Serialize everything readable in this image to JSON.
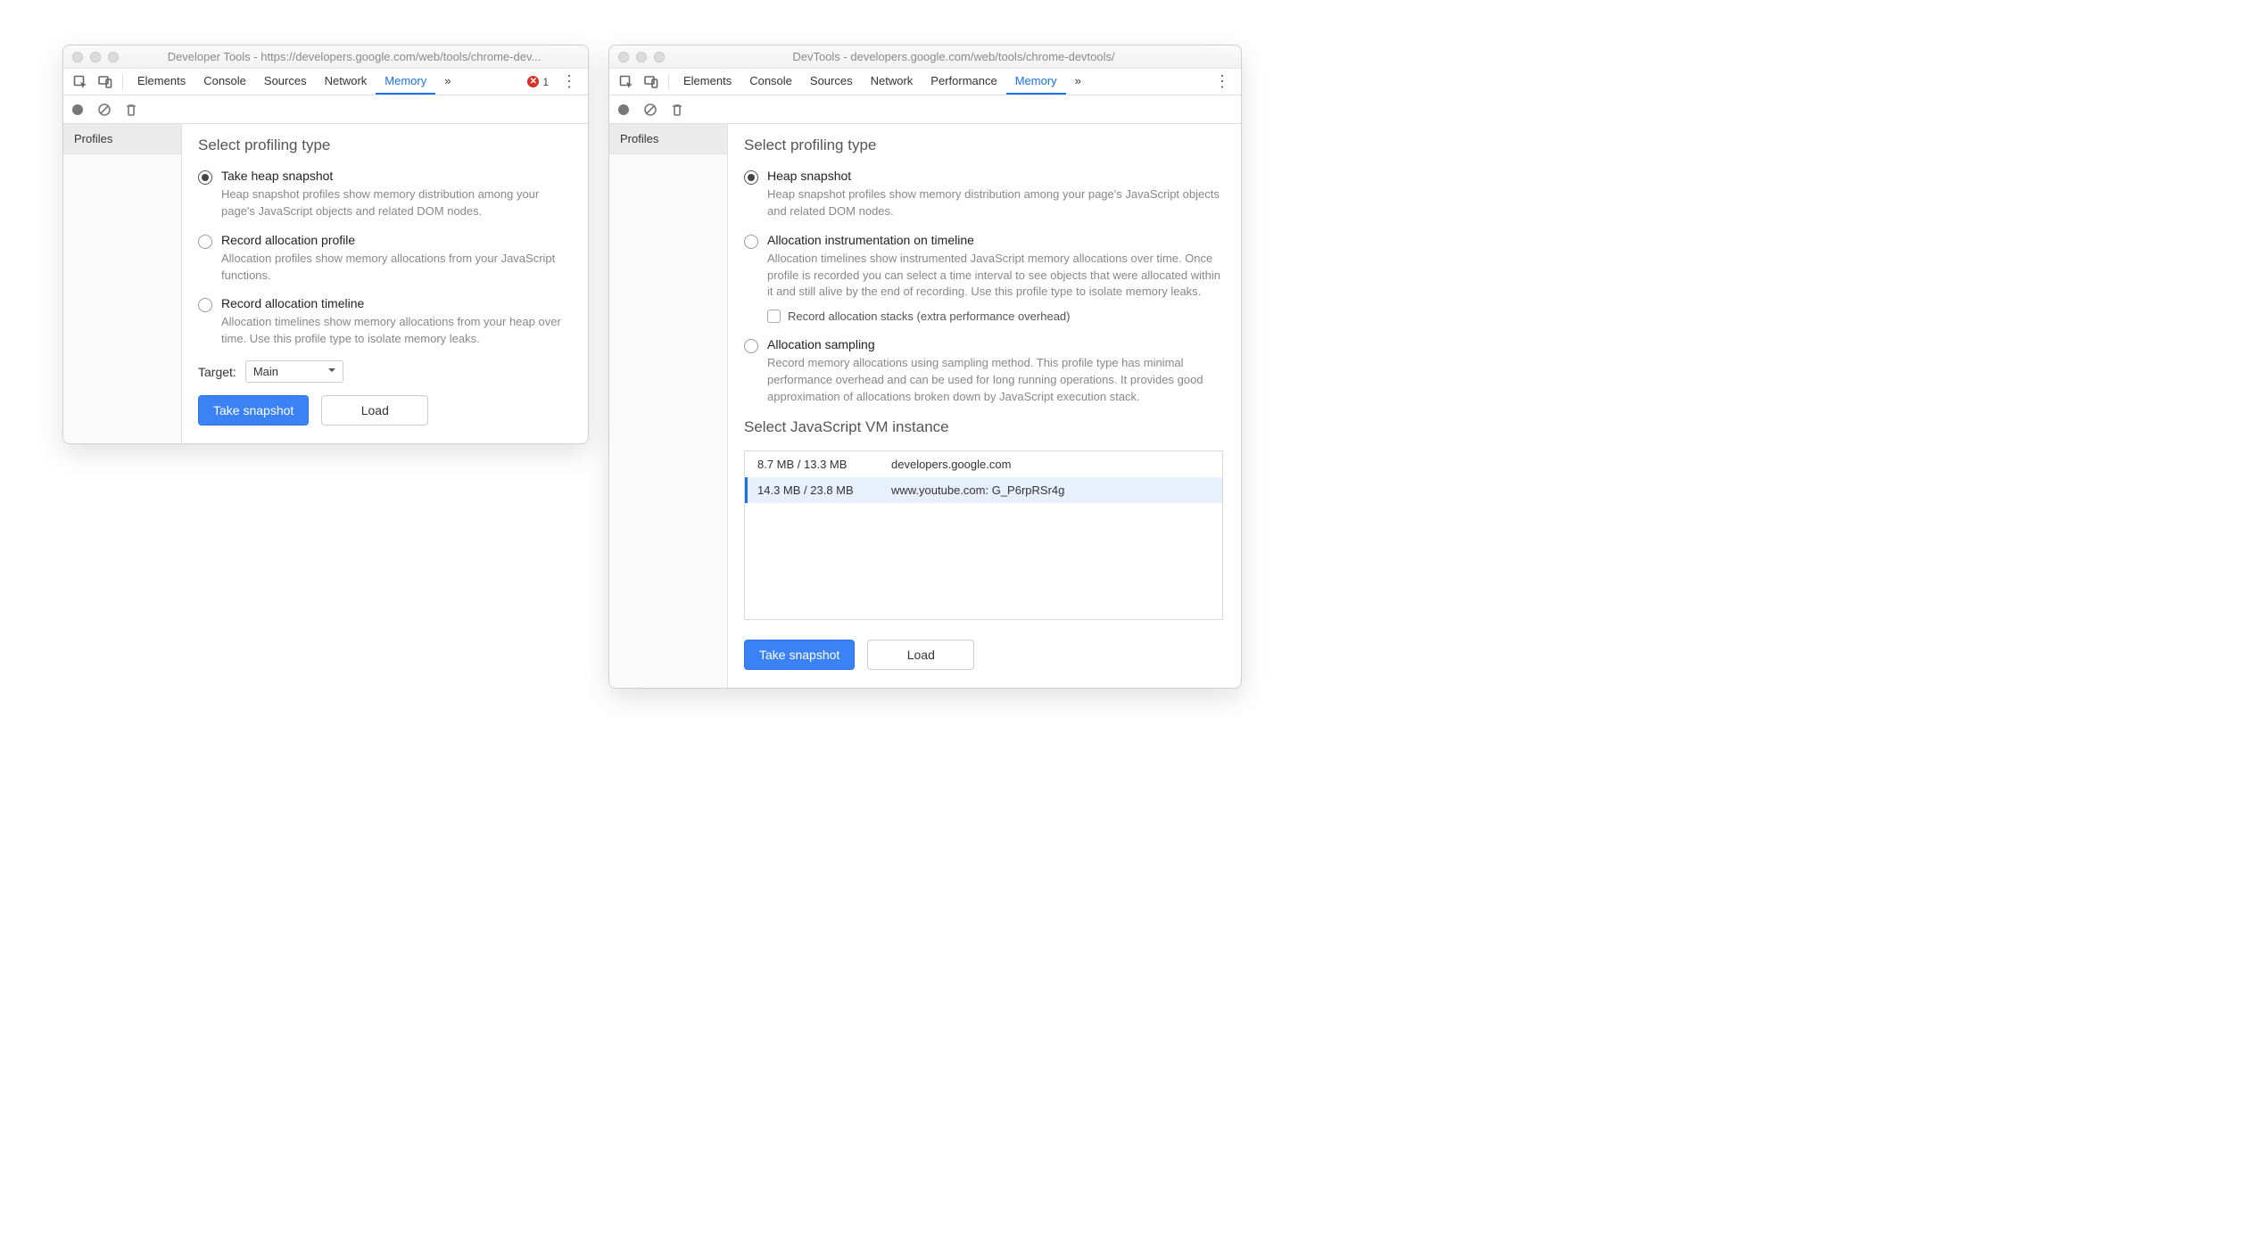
{
  "left": {
    "title": "Developer Tools - https://developers.google.com/web/tools/chrome-dev...",
    "tabs": [
      "Elements",
      "Console",
      "Sources",
      "Network",
      "Memory"
    ],
    "active_tab": "Memory",
    "overflow_glyph": "»",
    "error_count": "1",
    "sidebar": {
      "profiles": "Profiles"
    },
    "heading": "Select profiling type",
    "options": [
      {
        "title": "Take heap snapshot",
        "desc": "Heap snapshot profiles show memory distribution among your page's JavaScript objects and related DOM nodes.",
        "checked": true
      },
      {
        "title": "Record allocation profile",
        "desc": "Allocation profiles show memory allocations from your JavaScript functions.",
        "checked": false
      },
      {
        "title": "Record allocation timeline",
        "desc": "Allocation timelines show memory allocations from your heap over time. Use this profile type to isolate memory leaks.",
        "checked": false
      }
    ],
    "target_label": "Target:",
    "target_value": "Main",
    "buttons": {
      "primary": "Take snapshot",
      "secondary": "Load"
    }
  },
  "right": {
    "title": "DevTools - developers.google.com/web/tools/chrome-devtools/",
    "tabs": [
      "Elements",
      "Console",
      "Sources",
      "Network",
      "Performance",
      "Memory"
    ],
    "active_tab": "Memory",
    "overflow_glyph": "»",
    "sidebar": {
      "profiles": "Profiles"
    },
    "heading": "Select profiling type",
    "options": [
      {
        "title": "Heap snapshot",
        "desc": "Heap snapshot profiles show memory distribution among your page's JavaScript objects and related DOM nodes.",
        "checked": true
      },
      {
        "title": "Allocation instrumentation on timeline",
        "desc": "Allocation timelines show instrumented JavaScript memory allocations over time. Once profile is recorded you can select a time interval to see objects that were allocated within it and still alive by the end of recording. Use this profile type to isolate memory leaks.",
        "checked": false,
        "sub_checkbox": "Record allocation stacks (extra performance overhead)"
      },
      {
        "title": "Allocation sampling",
        "desc": "Record memory allocations using sampling method. This profile type has minimal performance overhead and can be used for long running operations. It provides good approximation of allocations broken down by JavaScript execution stack.",
        "checked": false
      }
    ],
    "vm_heading": "Select JavaScript VM instance",
    "vm_rows": [
      {
        "mem": "8.7 MB / 13.3 MB",
        "name": "developers.google.com",
        "selected": false
      },
      {
        "mem": "14.3 MB / 23.8 MB",
        "name": "www.youtube.com: G_P6rpRSr4g",
        "selected": true
      }
    ],
    "buttons": {
      "primary": "Take snapshot",
      "secondary": "Load"
    }
  }
}
